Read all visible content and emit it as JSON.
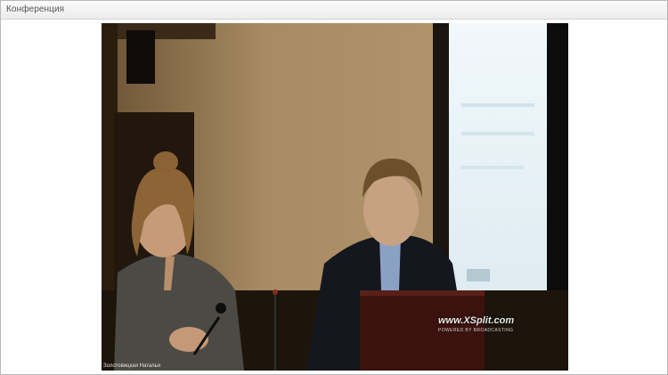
{
  "window": {
    "title": "Конференция"
  },
  "video": {
    "caption": "Золотовицкая Наталья",
    "watermark": "www.XSplit.com",
    "watermark_sub": "POWERED BY BROADCASTING"
  },
  "colors": {
    "titlebar": "#f1f1f1",
    "border": "#b9b9b9",
    "video_bg": "#1b1409",
    "wall": "#a78a62",
    "screen": "#eaf3f7"
  }
}
